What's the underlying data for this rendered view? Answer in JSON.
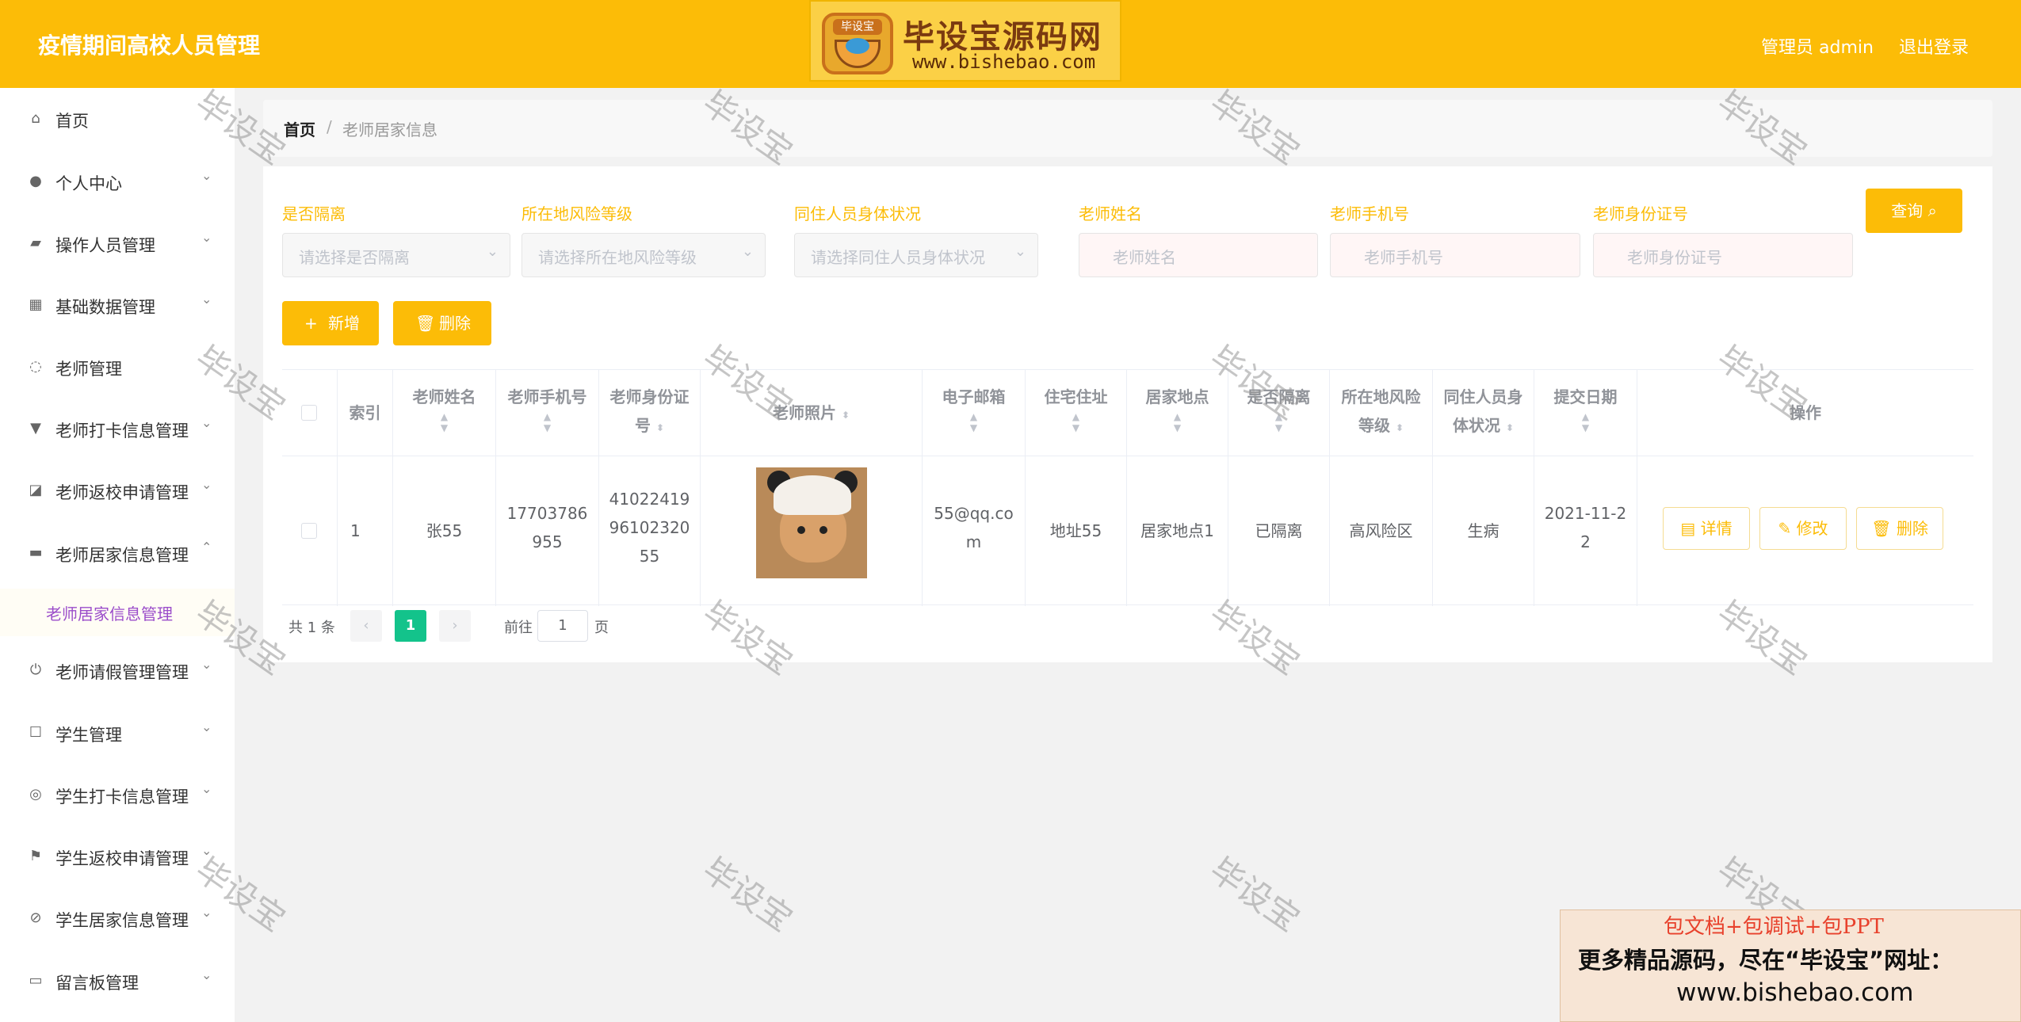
{
  "header": {
    "title": "疫情期间高校人员管理",
    "logo": {
      "brand": "毕设宝",
      "text": "毕设宝源码网",
      "url": "www.bishebao.com"
    },
    "admin": "管理员 admin",
    "logout": "退出登录"
  },
  "sidebar": {
    "items": [
      {
        "label": "首页",
        "icon": "home-icon",
        "expandable": false
      },
      {
        "label": "个人中心",
        "icon": "user-icon",
        "expandable": true
      },
      {
        "label": "操作人员管理",
        "icon": "operator-icon",
        "expandable": true
      },
      {
        "label": "基础数据管理",
        "icon": "grid-icon",
        "expandable": true
      },
      {
        "label": "老师管理",
        "icon": "teacher-icon",
        "expandable": false
      },
      {
        "label": "老师打卡信息管理",
        "icon": "checkin-icon",
        "expandable": true
      },
      {
        "label": "老师返校申请管理",
        "icon": "chart-icon",
        "expandable": true
      },
      {
        "label": "老师居家信息管理",
        "icon": "ticket-icon",
        "expandable": true,
        "open": true
      },
      {
        "label": "老师请假管理管理",
        "icon": "power-icon",
        "expandable": true
      },
      {
        "label": "学生管理",
        "icon": "message-icon",
        "expandable": true
      },
      {
        "label": "学生打卡信息管理",
        "icon": "compass-icon",
        "expandable": true
      },
      {
        "label": "学生返校申请管理",
        "icon": "flag-icon",
        "expandable": true
      },
      {
        "label": "学生居家信息管理",
        "icon": "bell-off-icon",
        "expandable": true
      },
      {
        "label": "留言板管理",
        "icon": "board-icon",
        "expandable": true
      }
    ],
    "submenu_active": "老师居家信息管理"
  },
  "breadcrumb": {
    "home": "首页",
    "separator": "/",
    "current": "老师居家信息"
  },
  "filters": [
    {
      "label": "是否隔离",
      "placeholder": "请选择是否隔离",
      "type": "select"
    },
    {
      "label": "所在地风险等级",
      "placeholder": "请选择所在地风险等级",
      "type": "select"
    },
    {
      "label": "同住人员身体状况",
      "placeholder": "请选择同住人员身体状况",
      "type": "select"
    },
    {
      "label": "老师姓名",
      "placeholder": "老师姓名",
      "type": "input"
    },
    {
      "label": "老师手机号",
      "placeholder": "老师手机号",
      "type": "input"
    },
    {
      "label": "老师身份证号",
      "placeholder": "老师身份证号",
      "type": "input"
    }
  ],
  "buttons": {
    "query": "查询",
    "add": "新增",
    "delete": "删除"
  },
  "table": {
    "headers": {
      "index": "索引",
      "name": [
        "老师姓名"
      ],
      "phone": [
        "老师手机号"
      ],
      "idcard": [
        "老师身份证",
        "号"
      ],
      "photo": "老师照片",
      "email": [
        "电子邮箱"
      ],
      "address": [
        "住宅住址"
      ],
      "home": [
        "居家地点"
      ],
      "isolated": [
        "是否隔离"
      ],
      "risk": [
        "所在地风险",
        "等级"
      ],
      "cohabit": [
        "同住人员身",
        "体状况"
      ],
      "date": [
        "提交日期"
      ],
      "ops": "操作"
    },
    "rows": [
      {
        "index": "1",
        "name": "张55",
        "phone": [
          "17703786",
          "955"
        ],
        "idcard": [
          "41022419",
          "96102320",
          "55"
        ],
        "email": [
          "55@qq.co",
          "m"
        ],
        "address": "地址55",
        "home": "居家地点1",
        "isolated": "已隔离",
        "risk": "高风险区",
        "cohabit": "生病",
        "date": [
          "2021-11-2",
          "2"
        ],
        "ops": {
          "detail": "详情",
          "edit": "修改",
          "delete": "删除"
        }
      }
    ]
  },
  "pagination": {
    "total": "共 1 条",
    "current": "1",
    "goto": "前往",
    "page_input": "1",
    "page_unit": "页"
  },
  "watermark": "毕设宝",
  "promo": {
    "line1": "包文档+包调试+包PPT",
    "line2": "更多精品源码，尽在“毕设宝”网址：",
    "line3": "www.bishebao.com"
  },
  "colors": {
    "accent": "#fcbc07",
    "pager_active": "#13c38b",
    "submenu_text": "#9b4dca"
  }
}
